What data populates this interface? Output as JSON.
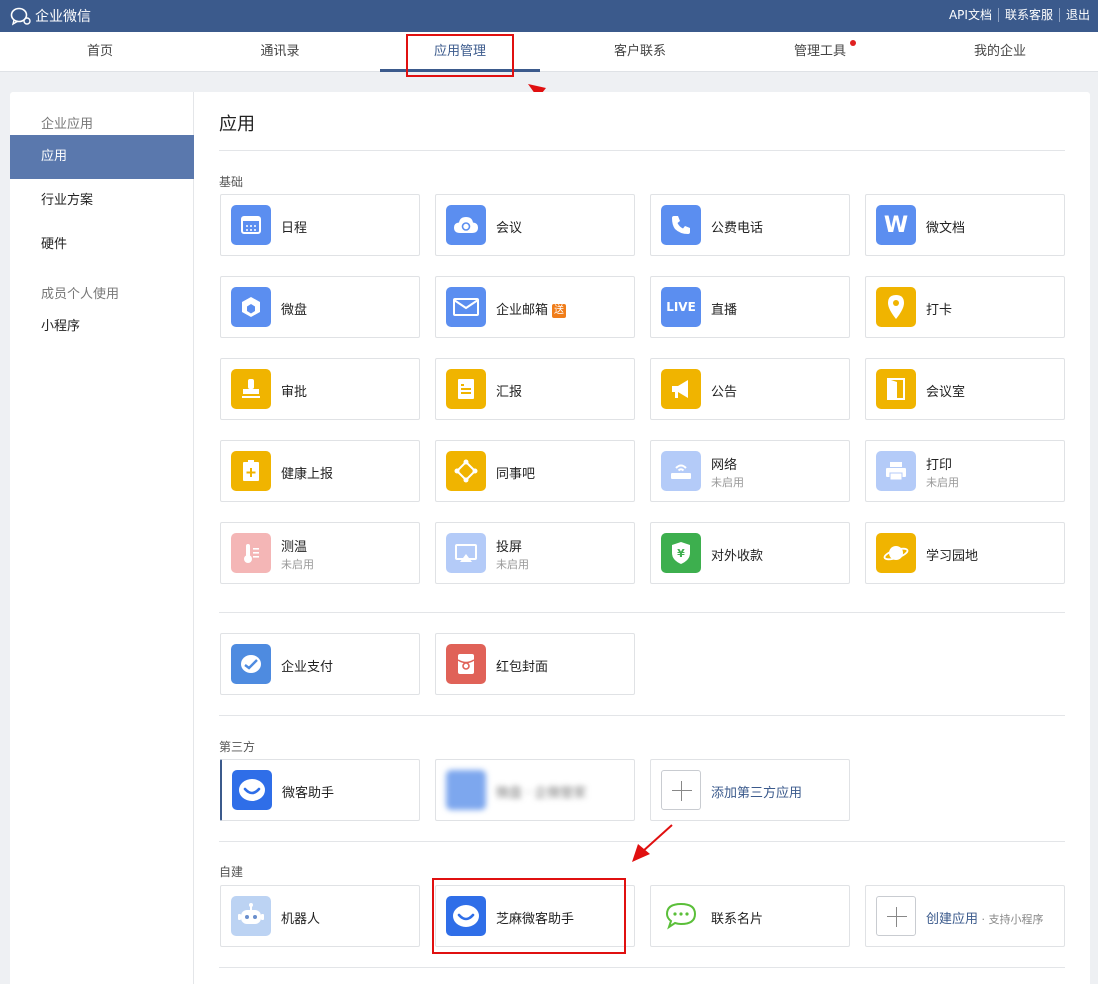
{
  "app": {
    "logo_text": "企业微信"
  },
  "toplinks": [
    "API文档",
    "联系客服",
    "退出"
  ],
  "nav": [
    "首页",
    "通讯录",
    "应用管理",
    "客户联系",
    "管理工具",
    "我的企业"
  ],
  "sidebar": {
    "group1": "企业应用",
    "items1": [
      "应用",
      "行业方案",
      "硬件"
    ],
    "group2": "成员个人使用",
    "items2": [
      "小程序"
    ]
  },
  "main": {
    "title": "应用",
    "section_basic": "基础",
    "section_third": "第三方",
    "section_custom": "自建"
  },
  "apps": {
    "calendar": "日程",
    "meeting": "会议",
    "phone": "公费电话",
    "doc": "微文档",
    "drive": "微盘",
    "mail": "企业邮箱",
    "mail_badge": "送",
    "live": "直播",
    "checkin": "打卡",
    "approval": "审批",
    "report": "汇报",
    "notice": "公告",
    "room": "会议室",
    "health": "健康上报",
    "colleague": "同事吧",
    "network": "网络",
    "network_status": "未启用",
    "print": "打印",
    "print_status": "未启用",
    "temp": "测温",
    "temp_status": "未启用",
    "screen": "投屏",
    "screen_status": "未启用",
    "payment": "对外收款",
    "learn": "学习园地",
    "pay": "企业支付",
    "redpacket": "红包封面",
    "wk_helper": "微客助手",
    "blurred_app": "微盘 · 企微管家",
    "add_third": "添加第三方应用",
    "robot": "机器人",
    "zhima": "芝麻微客助手",
    "card": "联系名片",
    "create": "创建应用",
    "create_sub": " · 支持小程序"
  },
  "icons": {
    "calendar": "calendar-icon",
    "meeting": "cloud-icon",
    "phone": "phone-icon",
    "doc": "w-doc-icon",
    "drive": "cube-icon",
    "mail": "envelope-icon",
    "live": "live-icon",
    "checkin": "location-pin-icon",
    "approval": "stamp-icon",
    "report": "clipboard-icon",
    "notice": "megaphone-icon",
    "room": "door-icon",
    "health": "medical-plus-icon",
    "colleague": "network-nodes-icon",
    "network": "router-icon",
    "print": "printer-icon",
    "temp": "thermometer-icon",
    "screen": "screen-cast-icon",
    "payment": "yuan-shield-icon",
    "learn": "planet-icon",
    "pay": "wallet-check-icon",
    "redpacket": "red-packet-icon",
    "wk_helper": "smile-bubble-icon",
    "robot": "robot-icon",
    "zhima": "smile-bubble-icon",
    "card": "chat-bubble-icon"
  },
  "colors": {
    "topbar": "#3b5a8c",
    "accent": "#5a78ad",
    "highlight": "#e01010"
  }
}
